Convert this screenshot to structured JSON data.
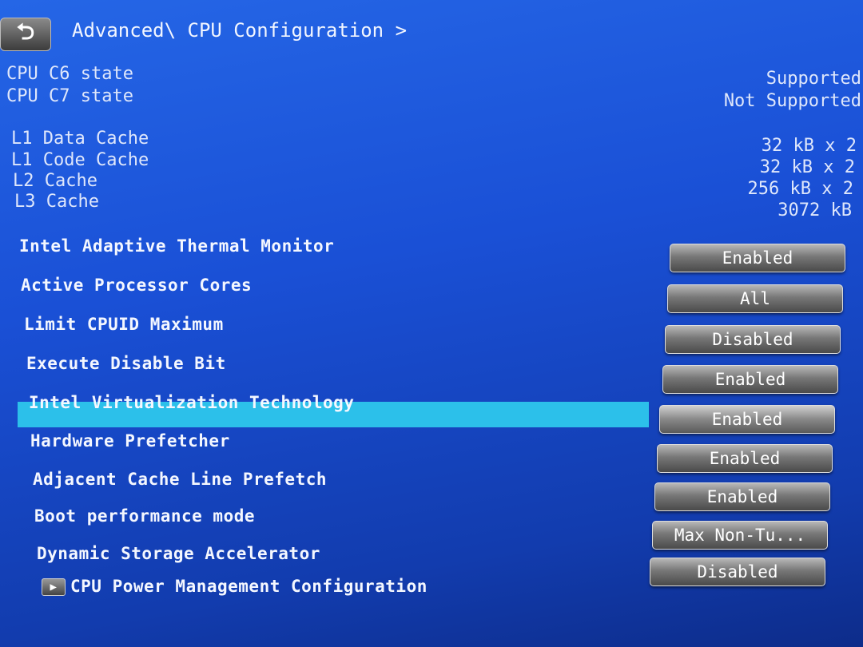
{
  "header": {
    "back_icon": "back-arrow-icon",
    "breadcrumb": "Advanced\\ CPU Configuration >"
  },
  "cstates": [
    {
      "label": "CPU C6 state",
      "value": "Supported"
    },
    {
      "label": "CPU C7 state",
      "value": "Not Supported"
    }
  ],
  "caches": [
    {
      "label": "L1 Data Cache",
      "value": "32 kB x 2"
    },
    {
      "label": "L1 Code Cache",
      "value": "32 kB x 2"
    },
    {
      "label": "L2 Cache",
      "value": "256 kB x 2"
    },
    {
      "label": "L3 Cache",
      "value": "3072 kB"
    }
  ],
  "settings": [
    {
      "label": "Intel Adaptive Thermal Monitor",
      "value": "Enabled"
    },
    {
      "label": "Active Processor Cores",
      "value": "All"
    },
    {
      "label": "Limit CPUID Maximum",
      "value": "Disabled"
    },
    {
      "label": "Execute Disable Bit",
      "value": "Enabled"
    },
    {
      "label": "Intel Virtualization Technology",
      "value": "Enabled"
    },
    {
      "label": "Hardware Prefetcher",
      "value": "Enabled"
    },
    {
      "label": "Adjacent Cache Line Prefetch",
      "value": "Enabled"
    },
    {
      "label": "Boot performance mode",
      "value": "Max Non-Tu..."
    },
    {
      "label": "Dynamic Storage Accelerator",
      "value": "Disabled"
    }
  ],
  "submenu": {
    "label": "CPU Power Management Configuration",
    "icon": "submenu-arrow-icon"
  },
  "selected_index": 4
}
